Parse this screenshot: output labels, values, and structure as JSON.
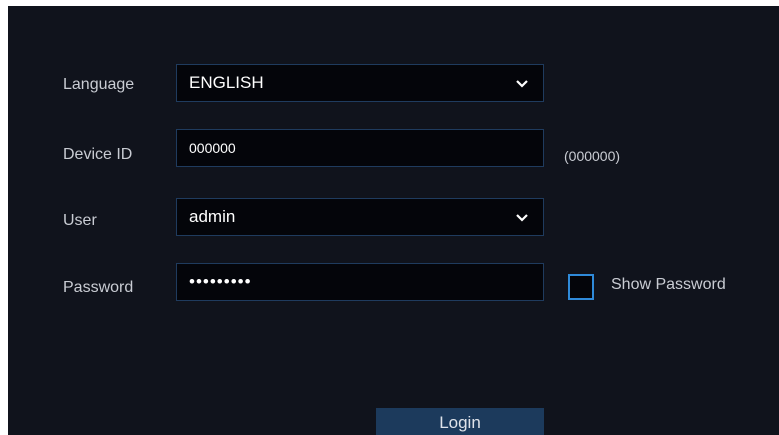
{
  "form": {
    "language": {
      "label": "Language",
      "value": "ENGLISH",
      "icon": "chevron-down-icon"
    },
    "device_id": {
      "label": "Device ID",
      "value": "000000",
      "hint": "(000000)"
    },
    "user": {
      "label": "User",
      "value": "admin",
      "icon": "chevron-down-icon"
    },
    "password": {
      "label": "Password",
      "value": "•••••••••",
      "show_label": "Show Password",
      "show_checked": false
    }
  },
  "login_button": {
    "label": "Login"
  },
  "colors": {
    "panel_bg": "#10131c",
    "field_bg": "#04050a",
    "field_border": "#1f3b5e",
    "checkbox_border": "#2f8ad9",
    "button_bg": "#1c3a5c"
  }
}
